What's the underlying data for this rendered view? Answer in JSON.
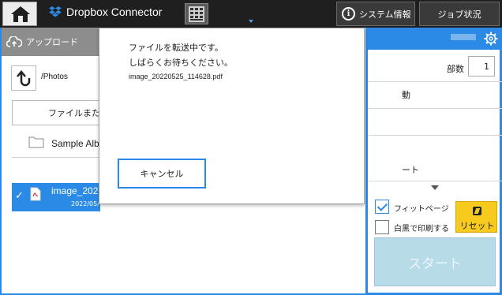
{
  "topbar": {
    "app_title": "Dropbox Connector",
    "system_info_label": "システム情報",
    "job_status_label": "ジョブ状況"
  },
  "left_panel": {
    "upload_label": "アップロード",
    "path": "/Photos",
    "file_select_label": "ファイルまた",
    "items": [
      {
        "name": "Sample Alb",
        "type": "folder"
      },
      {
        "name": "image_2022",
        "date": "2022/05/",
        "type": "pdf",
        "selected": true
      }
    ]
  },
  "right_panel": {
    "copies_label": "部数",
    "copies_value": "1",
    "row1_text": "動",
    "row2_text": "ート",
    "fit_page_label": "フィットページ",
    "fit_page_checked": true,
    "bw_print_label": "白黒で印刷する",
    "bw_print_checked": false,
    "reset_label": "リセット",
    "start_label": "スタート"
  },
  "dialog": {
    "message_line1": "ファイルを転送中です。",
    "message_line2": "しばらくお待ちください。",
    "file_name": "image_20220525_114628.pdf",
    "cancel_label": "キャンセル"
  },
  "colors": {
    "accent": "#2a8ae6",
    "topbar": "#1f1f1f",
    "reset": "#f7cb1e",
    "start_disabled": "#b8dbe8"
  }
}
